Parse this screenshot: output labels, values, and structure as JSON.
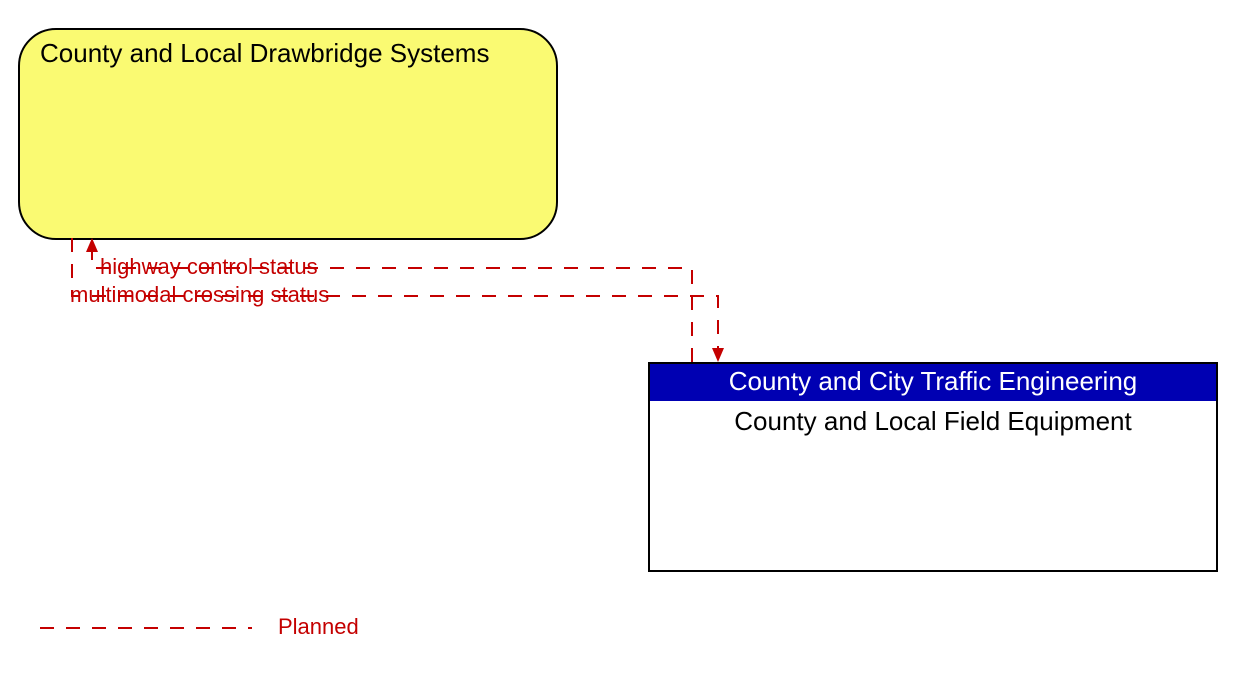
{
  "nodes": {
    "source": {
      "title": "County and Local Drawbridge Systems"
    },
    "target": {
      "header": "County and City Traffic Engineering",
      "body": "County and Local Field Equipment"
    }
  },
  "edges": {
    "flow1": "highway control status",
    "flow2": "multimodal crossing status"
  },
  "legend": {
    "planned": "Planned"
  }
}
